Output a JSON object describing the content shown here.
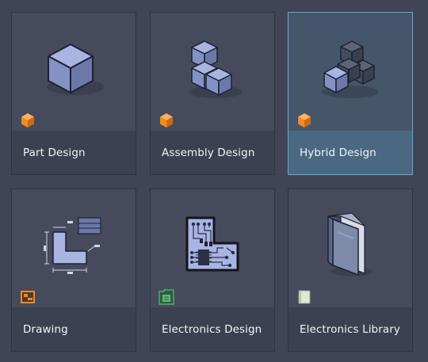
{
  "templates": [
    {
      "label": "Part Design",
      "icon": "single-cube-icon",
      "badge": "part-badge-icon",
      "selected": false
    },
    {
      "label": "Assembly Design",
      "icon": "three-cubes-icon",
      "badge": "assembly-badge-icon",
      "selected": false
    },
    {
      "label": "Hybrid Design",
      "icon": "hybrid-cubes-icon",
      "badge": "hybrid-badge-icon",
      "selected": true
    },
    {
      "label": "Drawing",
      "icon": "drawing-sheet-icon",
      "badge": "drawing-badge-icon",
      "selected": false
    },
    {
      "label": "Electronics Design",
      "icon": "circuit-board-icon",
      "badge": "electronics-badge-icon",
      "selected": false
    },
    {
      "label": "Electronics Library",
      "icon": "library-book-icon",
      "badge": "library-badge-icon",
      "selected": false
    }
  ],
  "colors": {
    "background": "#3f4556",
    "tile": "#454b5c",
    "caption": "#3b4150",
    "selected_border": "#62a9d3",
    "selected_caption": "#4a6882",
    "badge_orange": "#f08a24",
    "badge_green": "#5fb87a"
  }
}
